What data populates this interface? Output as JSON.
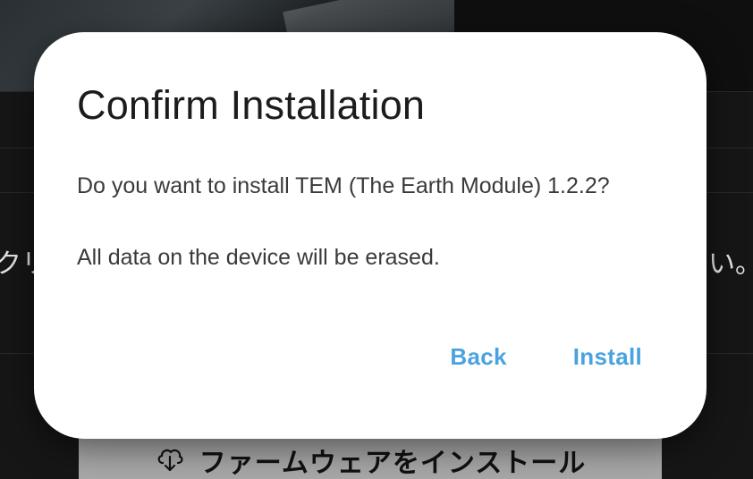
{
  "background": {
    "text_left_fragment": "クリ",
    "text_right_fragment": "い。",
    "install_button": {
      "label": "ファームウェアをインストール",
      "icon": "cloud-download-icon"
    }
  },
  "dialog": {
    "title": "Confirm Installation",
    "message": "Do you want to install TEM (The Earth Module) 1.2.2?",
    "warning": "All data on the device will be erased.",
    "actions": {
      "back_label": "Back",
      "install_label": "Install"
    }
  },
  "colors": {
    "accent": "#4aa3df",
    "dialog_bg": "#ffffff",
    "page_bg": "#141414",
    "bg_button": "#a9a9a9"
  }
}
